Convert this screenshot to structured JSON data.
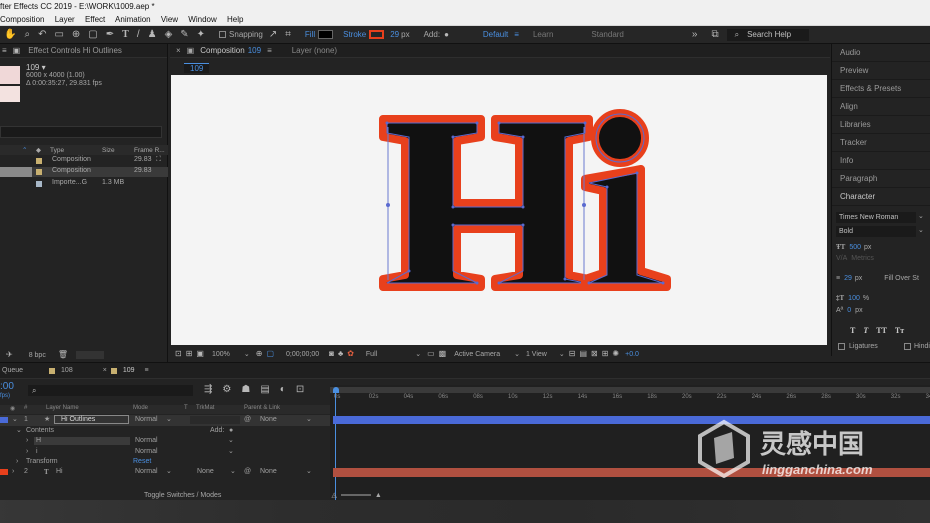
{
  "app": {
    "title": "fter Effects CC 2019 - E:\\WORK\\1009.aep *"
  },
  "menu": [
    "Composition",
    "Layer",
    "Effect",
    "Animation",
    "View",
    "Window",
    "Help"
  ],
  "toolbar": {
    "snapping": "Snapping",
    "fill": "Fill",
    "stroke": "Stroke",
    "stroke_px": "29",
    "px": "px",
    "add": "Add:",
    "workspace_default": "Default",
    "workspace_learn": "Learn",
    "workspace_standard": "Standard",
    "search": "Search Help",
    "fill_color": "#000000",
    "stroke_color": "#e8401c"
  },
  "project": {
    "effect_controls": "Effect Controls Hi Outlines",
    "item_name": "109 ▾",
    "item_size": "6000 x 4000 (1.00)",
    "item_duration": "Δ 0:00:35:27, 29.831 fps",
    "cols": {
      "type": "Type",
      "size": "Size",
      "frame": "Frame R..."
    },
    "rows": [
      {
        "type": "Composition",
        "frame": "29.83"
      },
      {
        "type": "Composition",
        "frame": "29.83"
      },
      {
        "type": "Importe...G",
        "size": "1.3 MB"
      }
    ],
    "bpc": "8 bpc"
  },
  "comp": {
    "tab": "Composition",
    "tab_num": "109",
    "layer": "Layer (none)",
    "breadcrumb": "109",
    "zoom": "100%",
    "timecode": "0;00;00;00",
    "quality": "Full",
    "camera": "Active Camera",
    "view": "1 View",
    "offset": "+0.0",
    "graphic_text_1": "Hi"
  },
  "right_panel": {
    "items": [
      "Audio",
      "Preview",
      "Effects & Presets",
      "Align",
      "Libraries",
      "Tracker",
      "Info",
      "Paragraph",
      "Character"
    ],
    "font": "Times New Roman",
    "style": "Bold",
    "size": "500",
    "size_unit": "px",
    "leading": "Metrics",
    "stroke_w": "29",
    "stroke_unit": "px",
    "stroke_type": "Fill Over St",
    "vscale": "100",
    "vscale_unit": "%",
    "baseline": "0",
    "baseline_unit": "px",
    "ligatures": "Ligatures",
    "hindi": "Hindi"
  },
  "timeline": {
    "queue_tab": "Queue",
    "tab_108": "108",
    "tab_109": "109",
    "timecode": ":00",
    "fps": "fps)",
    "header": {
      "num": "#",
      "name": "Layer Name",
      "mode": "Mode",
      "t": "T",
      "trkmat": "TrkMat",
      "parent": "Parent & Link"
    },
    "layers": [
      {
        "num": "1",
        "name": "Hi Outlines",
        "mode": "Normal",
        "parent": "None"
      },
      {
        "name": "Contents",
        "add": "Add:"
      },
      {
        "name": "H",
        "mode": "Normal"
      },
      {
        "name": "i",
        "mode": "Normal"
      },
      {
        "name": "Transform",
        "reset": "Reset"
      },
      {
        "num": "2",
        "name": "Hi",
        "mode": "Normal",
        "trkmat": "None",
        "parent": "None"
      }
    ],
    "ruler": [
      "0s",
      "02s",
      "04s",
      "06s",
      "08s",
      "10s",
      "12s",
      "14s",
      "16s",
      "18s",
      "20s",
      "22s",
      "24s",
      "26s",
      "28s",
      "30s",
      "32s",
      "34s"
    ],
    "toggle": "Toggle Switches / Modes"
  },
  "watermark": {
    "cn": "灵感中国",
    "url": "lingganchina.com"
  }
}
